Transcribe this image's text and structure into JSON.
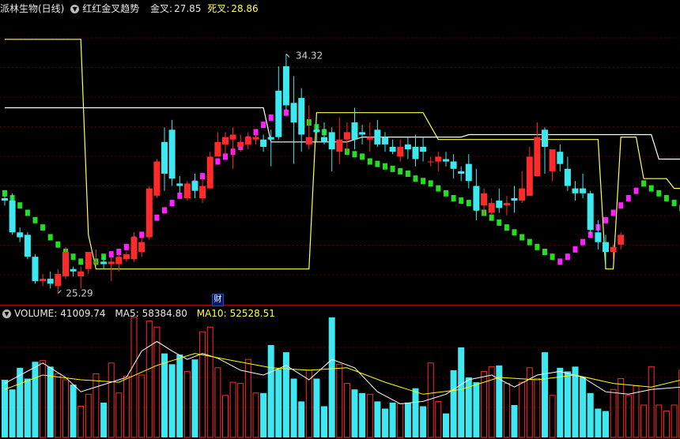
{
  "header": {
    "stock_title": "派林生物(日线)",
    "indicator_name": "红红金叉趋势",
    "golden_label": "金叉:",
    "golden_value": "27.85",
    "death_label": "死叉:",
    "death_value": "28.86"
  },
  "volume_header": {
    "volume_label": "VOLUME:",
    "volume_value": "41009.74",
    "ma5_label": "MA5:",
    "ma5_value": "58384.80",
    "ma10_label": "MA10:",
    "ma10_value": "52528.51"
  },
  "finance_marker": "财",
  "colors": {
    "up": "#ff2a2a",
    "down": "#3ee8f0",
    "golden_line": "#ffff55",
    "death_line": "#ffffff",
    "trend_green": "#22dd22",
    "trend_magenta": "#ff22ff",
    "divider": "#aa0000",
    "ma5": "#ffffff",
    "ma10": "#ffff00"
  },
  "chart_data": {
    "type": "candlestick",
    "y_range_price": [
      24.1,
      35.8
    ],
    "max_annotation": "34.32",
    "min_annotation": "25.29",
    "volume_range": [
      0,
      100000
    ],
    "candles": [
      [
        28.4,
        28.5,
        28.1,
        28.3
      ],
      [
        28.3,
        28.6,
        26.9,
        27.0
      ],
      [
        27.0,
        27.2,
        26.6,
        26.8
      ],
      [
        26.9,
        27.0,
        25.9,
        26.0
      ],
      [
        26.0,
        26.1,
        24.9,
        25.0
      ],
      [
        25.0,
        25.3,
        24.8,
        25.1
      ],
      [
        25.1,
        25.4,
        24.7,
        24.9
      ],
      [
        24.8,
        25.5,
        24.5,
        25.3
      ],
      [
        25.2,
        26.4,
        25.1,
        26.2
      ],
      [
        25.5,
        25.6,
        25.2,
        25.4
      ],
      [
        25.2,
        25.6,
        24.7,
        25.4
      ],
      [
        25.5,
        26.0,
        25.3,
        26.2
      ],
      [
        25.8,
        26.3,
        25.6,
        25.8
      ],
      [
        25.8,
        26.0,
        25.5,
        25.7
      ],
      [
        25.7,
        26.0,
        25.0,
        25.8
      ],
      [
        25.7,
        26.1,
        25.4,
        26.0
      ],
      [
        25.9,
        26.2,
        25.8,
        26.1
      ],
      [
        25.9,
        27.0,
        25.8,
        26.8
      ],
      [
        26.2,
        26.8,
        26.0,
        26.6
      ],
      [
        26.8,
        28.9,
        26.7,
        28.8
      ],
      [
        28.5,
        30.0,
        28.4,
        29.9
      ],
      [
        30.7,
        31.3,
        28.7,
        29.4
      ],
      [
        31.2,
        31.6,
        28.9,
        29.2
      ],
      [
        29.0,
        29.3,
        28.6,
        28.9
      ],
      [
        28.4,
        29.1,
        28.3,
        29.0
      ],
      [
        29.1,
        29.4,
        28.4,
        28.7
      ],
      [
        28.4,
        29.2,
        28.2,
        28.9
      ],
      [
        28.8,
        30.3,
        28.8,
        30.1
      ],
      [
        30.1,
        31.1,
        30.2,
        30.7
      ],
      [
        30.6,
        31.1,
        30.2,
        30.9
      ],
      [
        30.8,
        31.3,
        29.6,
        31.0
      ],
      [
        30.5,
        31.0,
        30.3,
        30.7
      ],
      [
        30.6,
        31.1,
        30.4,
        30.9
      ],
      [
        30.8,
        31.1,
        30.6,
        30.9
      ],
      [
        30.8,
        31.0,
        30.3,
        30.5
      ],
      [
        30.9,
        31.2,
        29.7,
        30.8
      ],
      [
        32.8,
        33.8,
        30.8,
        30.9
      ],
      [
        33.8,
        34.3,
        32.0,
        32.2
      ],
      [
        32.3,
        33.4,
        29.8,
        31.5
      ],
      [
        32.5,
        32.9,
        30.3,
        31.0
      ],
      [
        30.6,
        32.2,
        30.4,
        30.9
      ],
      [
        31.2,
        31.4,
        30.7,
        31.1
      ],
      [
        30.9,
        31.5,
        30.6,
        30.7
      ],
      [
        31.1,
        31.3,
        29.5,
        30.4
      ],
      [
        30.3,
        31.7,
        29.8,
        30.8
      ],
      [
        30.8,
        31.5,
        30.3,
        31.1
      ],
      [
        31.5,
        32.1,
        30.4,
        30.8
      ],
      [
        31.1,
        31.4,
        30.6,
        31.0
      ],
      [
        30.8,
        31.5,
        30.3,
        30.9
      ],
      [
        31.2,
        31.6,
        30.5,
        30.6
      ],
      [
        30.9,
        31.1,
        30.3,
        30.6
      ],
      [
        30.5,
        30.8,
        30.2,
        30.3
      ],
      [
        30.1,
        30.8,
        29.9,
        30.5
      ],
      [
        30.6,
        30.9,
        30.0,
        30.4
      ],
      [
        30.5,
        31.0,
        29.7,
        30.0
      ],
      [
        30.5,
        30.9,
        29.9,
        30.3
      ],
      [
        29.9,
        30.1,
        29.7,
        29.9
      ],
      [
        29.9,
        30.3,
        29.5,
        30.1
      ],
      [
        30.0,
        30.3,
        29.7,
        29.9
      ],
      [
        29.9,
        30.2,
        29.2,
        29.6
      ],
      [
        29.5,
        29.7,
        29.1,
        29.4
      ],
      [
        29.8,
        30.2,
        28.8,
        29.1
      ],
      [
        28.9,
        29.6,
        27.5,
        27.9
      ],
      [
        28.1,
        28.8,
        27.7,
        28.6
      ],
      [
        27.8,
        28.4,
        27.7,
        28.2
      ],
      [
        28.3,
        28.8,
        27.8,
        28.0
      ],
      [
        28.1,
        28.5,
        27.7,
        28.2
      ],
      [
        28.4,
        28.9,
        27.8,
        28.3
      ],
      [
        28.3,
        29.5,
        28.2,
        28.8
      ],
      [
        28.5,
        30.5,
        28.5,
        30.1
      ],
      [
        29.3,
        31.5,
        29.6,
        30.9
      ],
      [
        31.2,
        31.3,
        29.4,
        30.5
      ],
      [
        29.5,
        30.2,
        29.1,
        30.4
      ],
      [
        30.3,
        30.6,
        29.5,
        29.8
      ],
      [
        29.6,
        30.1,
        28.7,
        28.9
      ],
      [
        28.8,
        29.1,
        28.3,
        28.6
      ],
      [
        28.8,
        29.4,
        28.4,
        28.6
      ],
      [
        28.6,
        28.7,
        26.9,
        27.1
      ],
      [
        27.0,
        27.5,
        26.3,
        26.6
      ],
      [
        26.6,
        26.9,
        25.6,
        26.2
      ],
      [
        26.2,
        26.5,
        25.9,
        26.4
      ],
      [
        26.5,
        27.0,
        26.3,
        26.9
      ]
    ],
    "golden_cross_line": [
      [
        0,
        34.9
      ],
      [
        10,
        34.9
      ],
      [
        11,
        26.9
      ],
      [
        12,
        25.5
      ],
      [
        40,
        25.5
      ],
      [
        41,
        31.9
      ],
      [
        55,
        31.9
      ],
      [
        57,
        30.8
      ],
      [
        78,
        30.8
      ],
      [
        79,
        25.5
      ],
      [
        80,
        25.5
      ],
      [
        81,
        30.9
      ],
      [
        83,
        30.9
      ],
      [
        84,
        29.2
      ],
      [
        87,
        29.2
      ],
      [
        88,
        28.8
      ],
      [
        89,
        28.8
      ]
    ],
    "death_cross_line": [
      [
        0,
        32.1
      ],
      [
        34,
        32.1
      ],
      [
        35,
        30.7
      ],
      [
        42,
        30.7
      ],
      [
        45,
        30.7
      ],
      [
        47,
        30.9
      ],
      [
        54,
        30.9
      ],
      [
        60,
        30.9
      ],
      [
        61,
        31.0
      ],
      [
        85,
        31.0
      ],
      [
        86,
        30.0
      ],
      [
        95,
        30.0
      ]
    ],
    "trend_dots": [
      [
        0,
        28.6,
        "g"
      ],
      [
        1,
        28.4,
        "g"
      ],
      [
        2,
        28.1,
        "g"
      ],
      [
        3,
        27.8,
        "g"
      ],
      [
        4,
        27.5,
        "g"
      ],
      [
        5,
        27.2,
        "g"
      ],
      [
        6,
        26.8,
        "g"
      ],
      [
        7,
        26.5,
        "g"
      ],
      [
        8,
        26.2,
        "g"
      ],
      [
        9,
        26.0,
        "g"
      ],
      [
        10,
        25.8,
        "g"
      ],
      [
        11,
        25.7,
        "g"
      ],
      [
        12,
        25.8,
        "g"
      ],
      [
        13,
        26.0,
        "g"
      ],
      [
        14,
        26.1,
        "m"
      ],
      [
        15,
        26.2,
        "m"
      ],
      [
        16,
        26.4,
        "m"
      ],
      [
        17,
        26.7,
        "m"
      ],
      [
        18,
        26.9,
        "m"
      ],
      [
        19,
        27.2,
        "m"
      ],
      [
        20,
        27.6,
        "m"
      ],
      [
        21,
        27.9,
        "m"
      ],
      [
        22,
        28.2,
        "m"
      ],
      [
        23,
        28.5,
        "m"
      ],
      [
        24,
        28.8,
        "m"
      ],
      [
        25,
        29.0,
        "m"
      ],
      [
        26,
        29.3,
        "m"
      ],
      [
        27,
        29.6,
        "m"
      ],
      [
        28,
        29.9,
        "m"
      ],
      [
        29,
        30.1,
        "m"
      ],
      [
        30,
        30.3,
        "m"
      ],
      [
        31,
        30.5,
        "m"
      ],
      [
        32,
        30.8,
        "m"
      ],
      [
        33,
        31.1,
        "m"
      ],
      [
        34,
        31.4,
        "m"
      ],
      [
        35,
        31.7,
        "m"
      ],
      [
        36,
        31.8,
        "m"
      ],
      [
        37,
        31.9,
        "m"
      ],
      [
        38,
        31.9,
        "m"
      ],
      [
        39,
        31.7,
        "g"
      ],
      [
        40,
        31.5,
        "g"
      ],
      [
        41,
        31.3,
        "g"
      ],
      [
        42,
        31.1,
        "g"
      ],
      [
        43,
        30.8,
        "g"
      ],
      [
        44,
        30.5,
        "g"
      ],
      [
        45,
        30.3,
        "g"
      ],
      [
        46,
        30.2,
        "g"
      ],
      [
        47,
        30.1,
        "g"
      ],
      [
        48,
        29.9,
        "g"
      ],
      [
        49,
        29.8,
        "g"
      ],
      [
        50,
        29.7,
        "g"
      ],
      [
        51,
        29.6,
        "g"
      ],
      [
        52,
        29.5,
        "g"
      ],
      [
        53,
        29.4,
        "g"
      ],
      [
        54,
        29.2,
        "g"
      ],
      [
        55,
        29.1,
        "g"
      ],
      [
        56,
        29.0,
        "g"
      ],
      [
        57,
        28.8,
        "g"
      ],
      [
        58,
        28.6,
        "g"
      ],
      [
        59,
        28.4,
        "g"
      ],
      [
        60,
        28.3,
        "g"
      ],
      [
        61,
        28.2,
        "g"
      ],
      [
        62,
        28.0,
        "g"
      ],
      [
        63,
        27.8,
        "g"
      ],
      [
        64,
        27.6,
        "g"
      ],
      [
        65,
        27.4,
        "g"
      ],
      [
        66,
        27.2,
        "g"
      ],
      [
        67,
        27.0,
        "g"
      ],
      [
        68,
        26.8,
        "g"
      ],
      [
        69,
        26.6,
        "g"
      ],
      [
        70,
        26.4,
        "g"
      ],
      [
        71,
        26.2,
        "g"
      ],
      [
        72,
        26.0,
        "g"
      ],
      [
        73,
        25.8,
        "m"
      ],
      [
        74,
        26.0,
        "m"
      ],
      [
        75,
        26.3,
        "m"
      ],
      [
        76,
        26.6,
        "m"
      ],
      [
        77,
        26.9,
        "m"
      ],
      [
        78,
        27.2,
        "m"
      ],
      [
        79,
        27.5,
        "m"
      ],
      [
        80,
        27.8,
        "m"
      ],
      [
        81,
        28.1,
        "m"
      ],
      [
        82,
        28.4,
        "m"
      ],
      [
        83,
        28.7,
        "m"
      ],
      [
        84,
        29.0,
        "g"
      ],
      [
        85,
        28.8,
        "g"
      ],
      [
        86,
        28.6,
        "g"
      ],
      [
        87,
        28.4,
        "g"
      ],
      [
        88,
        28.2,
        "g"
      ],
      [
        89,
        28.0,
        "g"
      ]
    ],
    "volume": [
      [
        0,
        48000
      ],
      [
        1,
        40000
      ],
      [
        2,
        58000
      ],
      [
        3,
        49000
      ],
      [
        4,
        63000
      ],
      [
        5,
        64000
      ],
      [
        6,
        59000
      ],
      [
        7,
        53000
      ],
      [
        8,
        48000
      ],
      [
        9,
        44000
      ],
      [
        10,
        26000
      ],
      [
        11,
        36000
      ],
      [
        12,
        53000
      ],
      [
        13,
        29000
      ],
      [
        14,
        62000
      ],
      [
        15,
        37000
      ],
      [
        16,
        51000
      ],
      [
        17,
        100000
      ],
      [
        18,
        52000
      ],
      [
        19,
        97000
      ],
      [
        20,
        92000
      ],
      [
        21,
        70000
      ],
      [
        22,
        61000
      ],
      [
        23,
        69000
      ],
      [
        24,
        55000
      ],
      [
        25,
        65000
      ],
      [
        26,
        88000
      ],
      [
        27,
        92000
      ],
      [
        28,
        58000
      ],
      [
        29,
        35000
      ],
      [
        30,
        46000
      ],
      [
        31,
        45000
      ],
      [
        32,
        65000
      ],
      [
        33,
        37000
      ],
      [
        34,
        37000
      ],
      [
        35,
        77000
      ],
      [
        36,
        57000
      ],
      [
        37,
        71000
      ],
      [
        38,
        49000
      ],
      [
        39,
        30000
      ],
      [
        40,
        56000
      ],
      [
        41,
        49000
      ],
      [
        42,
        26000
      ],
      [
        43,
        100000
      ],
      [
        44,
        61000
      ],
      [
        45,
        45000
      ],
      [
        46,
        40000
      ],
      [
        47,
        37000
      ],
      [
        48,
        36000
      ],
      [
        49,
        30000
      ],
      [
        50,
        24000
      ],
      [
        51,
        29000
      ],
      [
        52,
        28000
      ],
      [
        53,
        29000
      ],
      [
        54,
        41000
      ],
      [
        55,
        26000
      ],
      [
        56,
        62000
      ],
      [
        57,
        30000
      ],
      [
        58,
        20000
      ],
      [
        59,
        56000
      ],
      [
        60,
        75000
      ],
      [
        61,
        50000
      ],
      [
        62,
        46000
      ],
      [
        63,
        55000
      ],
      [
        64,
        59000
      ],
      [
        65,
        60000
      ],
      [
        66,
        45000
      ],
      [
        67,
        27000
      ],
      [
        68,
        46000
      ],
      [
        69,
        58000
      ],
      [
        70,
        49000
      ],
      [
        71,
        71000
      ],
      [
        72,
        35000
      ],
      [
        73,
        58000
      ],
      [
        74,
        55000
      ],
      [
        75,
        59000
      ],
      [
        76,
        50000
      ],
      [
        77,
        37000
      ],
      [
        78,
        24000
      ],
      [
        79,
        22000
      ],
      [
        80,
        40000
      ],
      [
        81,
        49000
      ],
      [
        82,
        35000
      ],
      [
        83,
        43000
      ],
      [
        84,
        27000
      ],
      [
        85,
        59000
      ],
      [
        86,
        27000
      ],
      [
        87,
        22000
      ],
      [
        88,
        27000
      ],
      [
        89,
        56000
      ]
    ],
    "ma5": [
      [
        0,
        45000
      ],
      [
        5,
        62000
      ],
      [
        8,
        50000
      ],
      [
        10,
        38000
      ],
      [
        13,
        44000
      ],
      [
        16,
        50000
      ],
      [
        18,
        72000
      ],
      [
        20,
        80000
      ],
      [
        22,
        72000
      ],
      [
        24,
        65000
      ],
      [
        26,
        70000
      ],
      [
        28,
        66000
      ],
      [
        31,
        56000
      ],
      [
        34,
        52000
      ],
      [
        37,
        60000
      ],
      [
        40,
        48000
      ],
      [
        43,
        65000
      ],
      [
        46,
        58000
      ],
      [
        49,
        38000
      ],
      [
        52,
        28000
      ],
      [
        55,
        30000
      ],
      [
        58,
        36000
      ],
      [
        61,
        48000
      ],
      [
        64,
        52000
      ],
      [
        67,
        42000
      ],
      [
        70,
        52000
      ],
      [
        73,
        55000
      ],
      [
        76,
        50000
      ],
      [
        79,
        38000
      ],
      [
        82,
        36000
      ],
      [
        85,
        40000
      ],
      [
        89,
        42000
      ]
    ],
    "ma10": [
      [
        0,
        40000
      ],
      [
        5,
        52000
      ],
      [
        10,
        48000
      ],
      [
        15,
        46000
      ],
      [
        20,
        60000
      ],
      [
        25,
        70000
      ],
      [
        30,
        64000
      ],
      [
        35,
        58000
      ],
      [
        40,
        56000
      ],
      [
        45,
        58000
      ],
      [
        50,
        46000
      ],
      [
        55,
        36000
      ],
      [
        60,
        40000
      ],
      [
        65,
        50000
      ],
      [
        70,
        48000
      ],
      [
        75,
        52000
      ],
      [
        80,
        45000
      ],
      [
        85,
        42000
      ],
      [
        89,
        48000
      ]
    ]
  }
}
